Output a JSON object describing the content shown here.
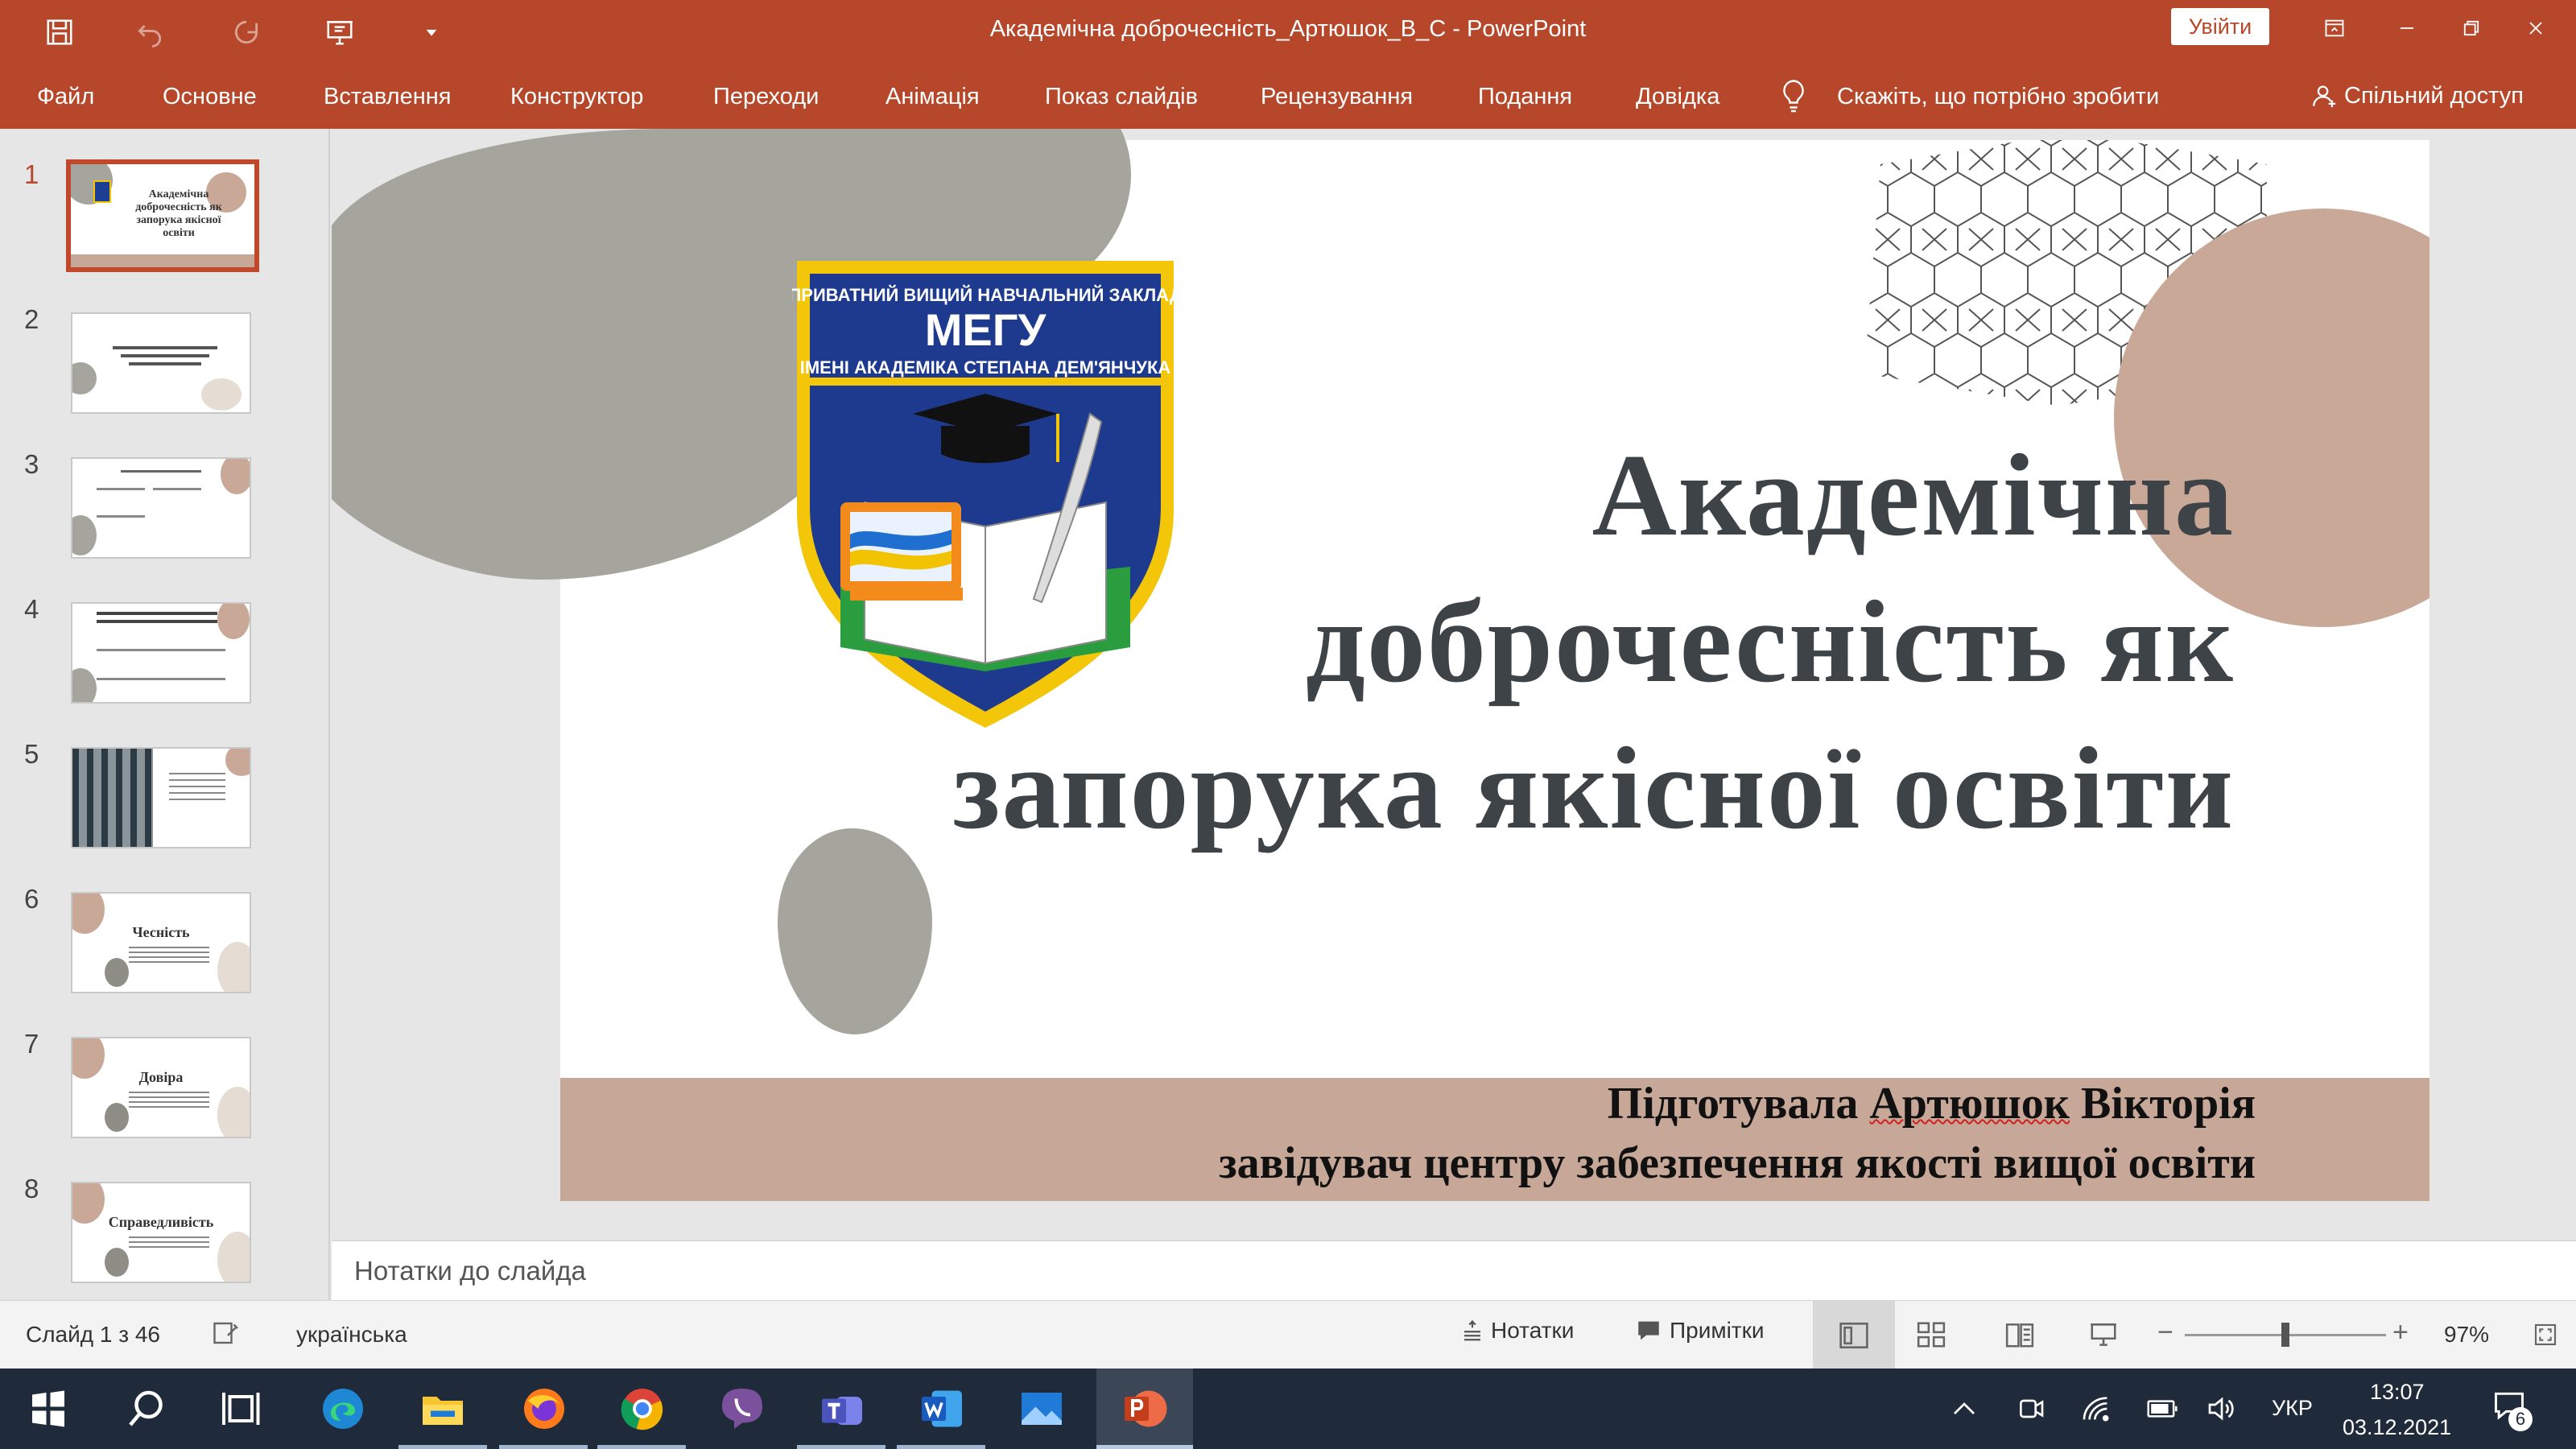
{
  "window": {
    "title": "Академічна доброчесність_Артюшок_В_С  -  PowerPoint",
    "signin_label": "Увійти"
  },
  "ribbon": {
    "tabs": [
      "Файл",
      "Основне",
      "Вставлення",
      "Конструктор",
      "Переходи",
      "Анімація",
      "Показ слайдів",
      "Рецензування",
      "Подання",
      "Довідка"
    ],
    "tell_me": "Скажіть, що потрібно зробити",
    "share": "Спільний доступ"
  },
  "thumbnails": [
    {
      "number": "1",
      "title": "Академічна доброчесність як запорука якісної освіти",
      "active": true
    },
    {
      "number": "2",
      "title": ""
    },
    {
      "number": "3",
      "title": ""
    },
    {
      "number": "4",
      "title": ""
    },
    {
      "number": "5",
      "title": ""
    },
    {
      "number": "6",
      "title": "Чесність"
    },
    {
      "number": "7",
      "title": "Довіра"
    },
    {
      "number": "8",
      "title": "Справедливість"
    }
  ],
  "slide": {
    "title": "Академічна\nдоброчесність як\nзапорука якісної освіти",
    "logo": {
      "line1": "ПРИВАТНИЙ ВИЩИЙ НАВЧАЛЬНИЙ ЗАКЛАД",
      "line2": "МЕГУ",
      "line3": "ІМЕНІ АКАДЕМІКА СТЕПАНА ДЕМ'ЯНЧУКА"
    },
    "author_prefix": "Підготувала ",
    "author_surname": "Артюшок",
    "author_name": " Вікторія",
    "author_role": "завідувач центру забезпечення якості вищої освіти"
  },
  "notes_placeholder": "Нотатки до слайда",
  "statusbar": {
    "slide_counter": "Слайд 1 з 46",
    "language": "українська",
    "notes_label": "Нотатки",
    "comments_label": "Примітки",
    "zoom": "97%",
    "zoom_level_fraction": 0.5
  },
  "taskbar": {
    "language": "УКР",
    "time": "13:07",
    "date": "03.12.2021",
    "notifications": "6"
  },
  "colors": {
    "accent": "#b7472a",
    "slide_text": "#3d4347",
    "band": "#c7a797",
    "blob_gray": "#a5a59d",
    "blob_tan": "#c9a898"
  }
}
